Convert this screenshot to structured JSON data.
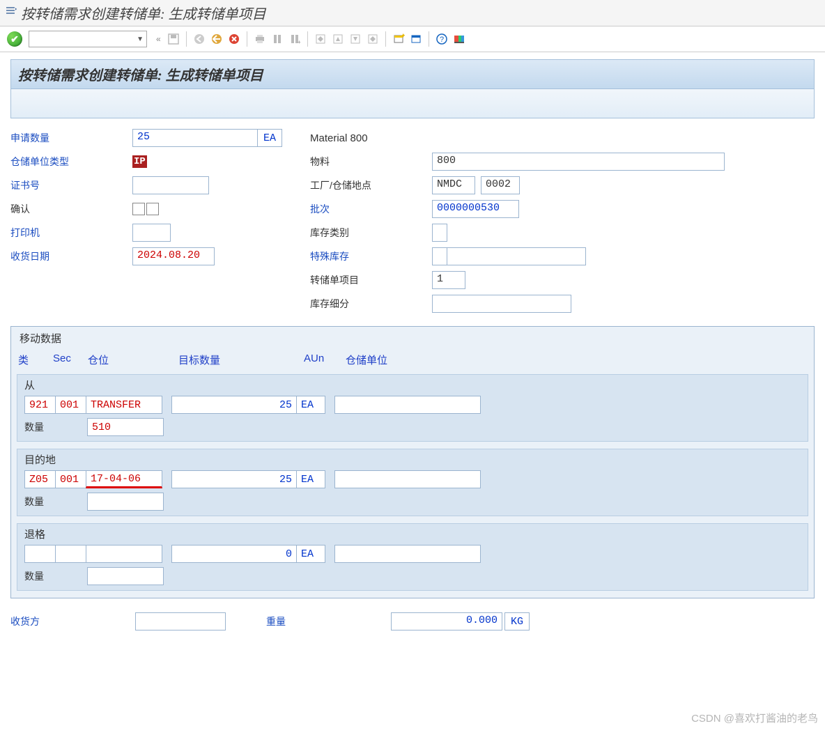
{
  "window": {
    "title": "按转储需求创建转储单: 生成转储单项目"
  },
  "header": {
    "title": "按转储需求创建转储单: 生成转储单项目"
  },
  "left": {
    "request_qty_label": "申请数量",
    "request_qty_value": "25",
    "request_qty_unit": "EA",
    "storage_unit_type_label": "仓储单位类型",
    "storage_unit_type_badge": "IP",
    "certificate_label": "证书号",
    "certificate_value": "",
    "confirm_label": "确认",
    "printer_label": "打印机",
    "printer_value": "",
    "gr_date_label": "收货日期",
    "gr_date_value": "2024.08.20"
  },
  "right": {
    "material_header": "Material 800",
    "material_label": "物料",
    "material_value": "800",
    "plant_label": "工厂/仓储地点",
    "plant_value": "NMDC",
    "storage_loc_value": "0002",
    "batch_label": "批次",
    "batch_value": "0000000530",
    "stock_cat_label": "库存类别",
    "stock_cat_value": "",
    "special_stock_label": "特殊库存",
    "special_stock_value": "",
    "special_stock_value2": "",
    "to_item_label": "转储单项目",
    "to_item_value": "1",
    "stock_segment_label": "库存细分",
    "stock_segment_value": ""
  },
  "movement": {
    "panel_title": "移动数据",
    "col_type": "类",
    "col_sec": "Sec",
    "col_bin": "仓位",
    "col_target_qty": "目标数量",
    "col_aun": "AUn",
    "col_su": "仓储单位",
    "from": {
      "label": "从",
      "type": "921",
      "sec": "001",
      "bin": "TRANSFER",
      "target_qty": "25",
      "aun": "EA",
      "su": "",
      "qty_label": "数量",
      "qty_value": "510"
    },
    "dest": {
      "label": "目的地",
      "type": "Z05",
      "sec": "001",
      "bin": "17-04-06",
      "target_qty": "25",
      "aun": "EA",
      "su": "",
      "qty_label": "数量",
      "qty_value": ""
    },
    "return": {
      "label": "退格",
      "type": "",
      "sec": "",
      "bin": "",
      "target_qty": "0",
      "aun": "EA",
      "su": "",
      "qty_label": "数量",
      "qty_value": ""
    }
  },
  "bottom": {
    "ship_to_label": "收货方",
    "ship_to_value": "",
    "weight_label": "重量",
    "weight_value": "0.000",
    "weight_unit": "KG"
  },
  "watermark": "CSDN @喜欢打酱油的老鸟"
}
